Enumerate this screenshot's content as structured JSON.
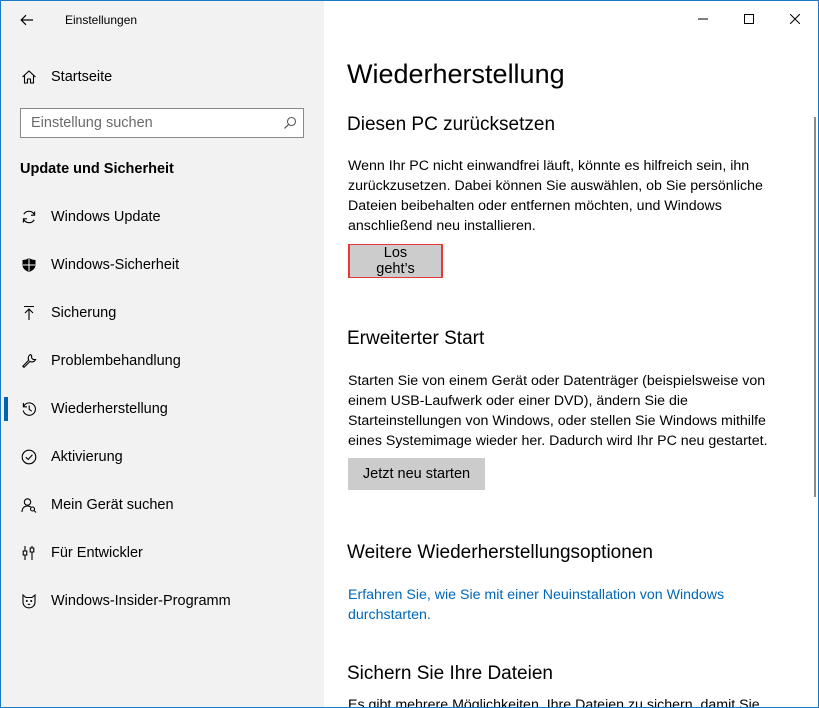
{
  "window": {
    "title": "Einstellungen"
  },
  "sidebar": {
    "home_label": "Startseite",
    "search_placeholder": "Einstellung suchen",
    "search_value": "",
    "section_heading": "Update und Sicherheit",
    "items": [
      {
        "label": "Windows Update",
        "icon": "sync-icon"
      },
      {
        "label": "Windows-Sicherheit",
        "icon": "shield-icon"
      },
      {
        "label": "Sicherung",
        "icon": "upload-arrow-icon"
      },
      {
        "label": "Problembehandlung",
        "icon": "wrench-icon"
      },
      {
        "label": "Wiederherstellung",
        "icon": "history-icon",
        "active": true
      },
      {
        "label": "Aktivierung",
        "icon": "check-circle-icon"
      },
      {
        "label": "Mein Gerät suchen",
        "icon": "person-search-icon"
      },
      {
        "label": "Für Entwickler",
        "icon": "developer-tools-icon"
      },
      {
        "label": "Windows-Insider-Programm",
        "icon": "insider-cat-icon"
      }
    ]
  },
  "main": {
    "page_title": "Wiederherstellung",
    "reset": {
      "heading": "Diesen PC zurücksetzen",
      "text": "Wenn Ihr PC nicht einwandfrei läuft, könnte es hilfreich sein, ihn zurückzusetzen. Dabei können Sie auswählen, ob Sie persönliche Dateien beibehalten oder entfernen möchten, und Windows anschließend neu installieren.",
      "button_label": "Los geht’s"
    },
    "advanced": {
      "heading": "Erweiterter Start",
      "text": "Starten Sie von einem Gerät oder Datenträger (beispielsweise von einem USB-Laufwerk oder einer DVD), ändern Sie die Starteinstellungen von Windows, oder stellen Sie Windows mithilfe eines Systemimage wieder her. Dadurch wird Ihr PC neu gestartet.",
      "button_label": "Jetzt neu starten"
    },
    "more": {
      "heading": "Weitere Wiederherstellungsoptionen",
      "link_text": "Erfahren Sie, wie Sie mit einer Neuinstallation von Windows durchstarten."
    },
    "backup": {
      "heading": "Sichern Sie Ihre Dateien",
      "text_partial": "Es gibt mehrere Möglichkeiten, Ihre Dateien zu sichern, damit Sie"
    }
  },
  "colors": {
    "accent": "#0063b1",
    "link": "#0067b8",
    "highlight_border": "#e53935",
    "sidebar_bg": "#f2f2f2",
    "button_bg": "#cccccc"
  }
}
